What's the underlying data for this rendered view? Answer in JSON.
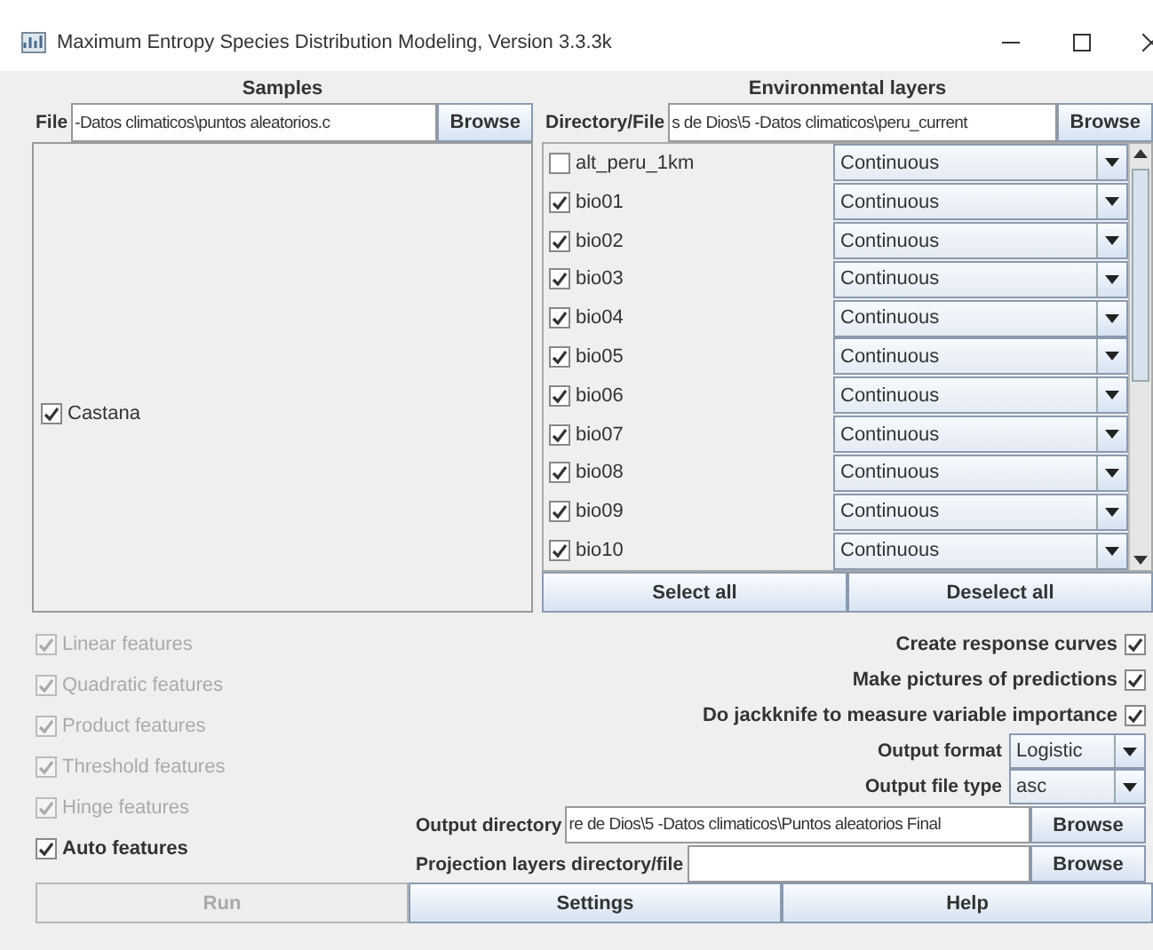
{
  "window": {
    "title": "Maximum Entropy Species Distribution Modeling, Version 3.3.3k"
  },
  "samples": {
    "heading": "Samples",
    "file_label": "File",
    "file_value": "-Datos climaticos\\puntos aleatorios.c",
    "browse": "Browse",
    "species": [
      {
        "label": "Castana",
        "checked": true
      }
    ]
  },
  "environmental_layers": {
    "heading": "Environmental layers",
    "dir_label": "Directory/File",
    "dir_value": "s de Dios\\5 -Datos climaticos\\peru_current",
    "browse": "Browse",
    "layers": [
      {
        "name": "alt_peru_1km",
        "checked": false,
        "type": "Continuous"
      },
      {
        "name": "bio01",
        "checked": true,
        "type": "Continuous"
      },
      {
        "name": "bio02",
        "checked": true,
        "type": "Continuous"
      },
      {
        "name": "bio03",
        "checked": true,
        "type": "Continuous"
      },
      {
        "name": "bio04",
        "checked": true,
        "type": "Continuous"
      },
      {
        "name": "bio05",
        "checked": true,
        "type": "Continuous"
      },
      {
        "name": "bio06",
        "checked": true,
        "type": "Continuous"
      },
      {
        "name": "bio07",
        "checked": true,
        "type": "Continuous"
      },
      {
        "name": "bio08",
        "checked": true,
        "type": "Continuous"
      },
      {
        "name": "bio09",
        "checked": true,
        "type": "Continuous"
      },
      {
        "name": "bio10",
        "checked": true,
        "type": "Continuous"
      }
    ],
    "select_all": "Select all",
    "deselect_all": "Deselect all"
  },
  "features": [
    {
      "label": "Linear features",
      "checked": true,
      "disabled": true
    },
    {
      "label": "Quadratic features",
      "checked": true,
      "disabled": true
    },
    {
      "label": "Product features",
      "checked": true,
      "disabled": true
    },
    {
      "label": "Threshold features",
      "checked": true,
      "disabled": true
    },
    {
      "label": "Hinge features",
      "checked": true,
      "disabled": true
    },
    {
      "label": "Auto features",
      "checked": true,
      "disabled": false
    }
  ],
  "options": [
    {
      "label": "Create response curves",
      "checked": true
    },
    {
      "label": "Make pictures of predictions",
      "checked": true
    },
    {
      "label": "Do jackknife to measure variable importance",
      "checked": true
    }
  ],
  "output_format": {
    "label": "Output format",
    "value": "Logistic"
  },
  "output_file_type": {
    "label": "Output file type",
    "value": "asc"
  },
  "output_directory": {
    "label": "Output directory",
    "value": "re de Dios\\5 -Datos climaticos\\Puntos aleatorios Final",
    "browse": "Browse"
  },
  "projection_layers": {
    "label": "Projection layers directory/file",
    "browse": "Browse"
  },
  "buttons": [
    {
      "label": "Run",
      "disabled": true
    },
    {
      "label": "Settings",
      "disabled": false
    },
    {
      "label": "Help",
      "disabled": false
    }
  ]
}
